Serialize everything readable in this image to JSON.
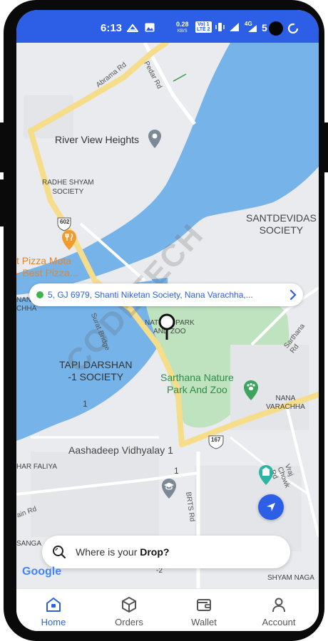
{
  "status_bar": {
    "time": "6:13",
    "speed_value": "0.28",
    "speed_unit": "KB/S",
    "volte_top": "Vo) 1",
    "volte_bottom": "LTE 2",
    "network": "4G",
    "battery": "5"
  },
  "map": {
    "labels": {
      "abrama_rd": "Abrama Rd",
      "pedar_rd": "Pedar Rd",
      "river_view": "River View Heights",
      "radhe_shyam_1": "RADHE SHYAM",
      "radhe_shyam_2": "SOCIETY",
      "highway_602": "602",
      "pizza_1": "t Pizza Mota",
      "pizza_2": "- Best Pizza...",
      "santdevidas_1": "SANTDEVIDAS",
      "santdevidas_2": "SOCIETY",
      "nana_left_1": "NANA",
      "nana_left_2": "CHHA",
      "nature_park_1": "NATURE PARK",
      "nature_park_2": "AND ZOO",
      "surat_bridge": "Surat Bridge",
      "sarthana_rd": "Sarthana Rd",
      "tapi_1": "TAPI DARSHAN",
      "tapi_2": "-1 SOCIETY",
      "one_a": "1",
      "sarthana_zoo_1": "Sarthana Nature",
      "sarthana_zoo_2": "Park And Zoo",
      "nana_varachha_1": "NANA",
      "nana_varachha_2": "VARACHHA",
      "highway_167": "167",
      "aashadeep": "Aashadeep Vidhyalay 1",
      "har_faliya": "HAR FALIYA",
      "one_b": "1",
      "brts_rd": "BRTS Rd",
      "vraj_chowk": "Vraj Chowk Rd",
      "ain_rd": "ain Rd",
      "sanga": "SANGA",
      "minus_two": "-2",
      "shyam_naga": "SHYAM NAGA"
    },
    "watermark": "CODETECH",
    "google_logo": "Google"
  },
  "address_bar": {
    "text": "5, GJ 6979, Shanti Niketan Society, Nana Varachha,..."
  },
  "search": {
    "prefix": "Where is your ",
    "emphasis": "Drop?"
  },
  "nav": {
    "home": "Home",
    "orders": "Orders",
    "wallet": "Wallet",
    "account": "Account"
  },
  "colors": {
    "primary": "#2d5fe6",
    "water": "#76b3e9",
    "park": "#bfe3bf",
    "highway": "#f6dd8a",
    "map_land": "#e9ebee"
  },
  "icons": [
    "home-icon",
    "box-icon",
    "wallet-icon",
    "user-icon",
    "search-icon",
    "chevron-right-icon",
    "map-pin-icon",
    "navigate-arrow-icon",
    "fork-knife-icon",
    "school-icon",
    "paw-icon",
    "landmark-icon"
  ]
}
